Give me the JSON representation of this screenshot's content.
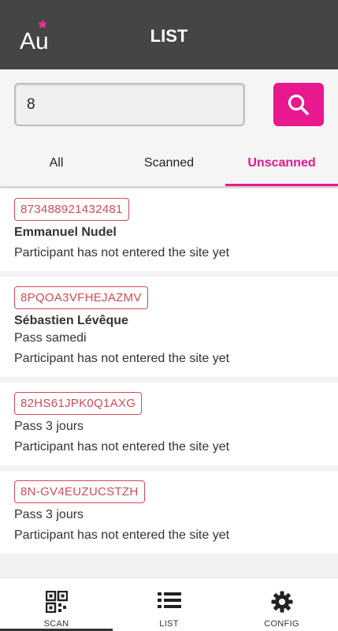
{
  "header": {
    "logo_text": "Au",
    "logo_star": "*",
    "title": "LIST"
  },
  "search": {
    "value": "8"
  },
  "tabs": [
    {
      "label": "All",
      "active": false
    },
    {
      "label": "Scanned",
      "active": false
    },
    {
      "label": "Unscanned",
      "active": true
    }
  ],
  "participants": [
    {
      "code": "873488921432481",
      "name": "Emmanuel Nudel",
      "pass": "",
      "status": "Participant has not entered the site yet"
    },
    {
      "code": "8PQOA3VFHEJAZMV",
      "name": "Sébastien Lévêque",
      "pass": "Pass samedi",
      "status": "Participant has not entered the site yet"
    },
    {
      "code": "82HS61JPK0Q1AXG",
      "name": "",
      "pass": "Pass 3 jours",
      "status": "Participant has not entered the site yet"
    },
    {
      "code": "8N-GV4EUZUCSTZH",
      "name": "",
      "pass": "Pass 3 jours",
      "status": "Participant has not entered the site yet"
    }
  ],
  "bottom_nav": [
    {
      "label": "SCAN",
      "icon": "qr-code-icon",
      "active": true
    },
    {
      "label": "LIST",
      "icon": "list-icon",
      "active": false
    },
    {
      "label": "CONFIG",
      "icon": "gear-icon",
      "active": false
    }
  ],
  "colors": {
    "accent": "#e8188e",
    "header_bg": "#454545",
    "badge": "#d24b53"
  }
}
